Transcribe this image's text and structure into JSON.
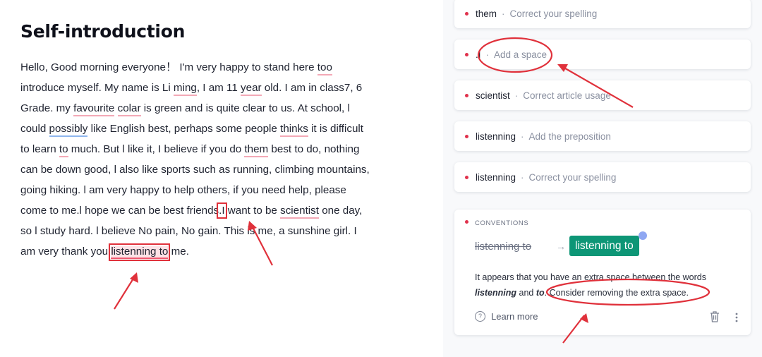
{
  "document": {
    "title": "Self-introduction",
    "lines": [
      [
        "Hello, Good morning everyone！ I'm very happy to stand here ",
        "too",
        ""
      ],
      [
        "introduce myself. My name is Li ",
        "ming",
        ", I am 11 ",
        "year",
        " old. I am in class7, 6"
      ],
      [
        "Grade. my ",
        "favourite",
        " ",
        "colar",
        " is green and is quite clear to us. At school, l"
      ],
      [
        "could ",
        "possibly",
        " like English best, perhaps some people ",
        "thinks",
        " it is difficult"
      ],
      [
        "to learn ",
        "to",
        " much. But l like it, I believe if you do ",
        "them",
        " best to do, nothing"
      ],
      [
        "can be down good, l also like sports such as running, climbing mountains,"
      ],
      [
        "going hiking. l am very happy to help others, if you need help, please"
      ],
      [
        "come to me.l  hope we can be best friends",
        ".I",
        " want to be ",
        "scientist",
        " one day,"
      ],
      [
        "so l study hard. l believe  No pain, No gain. This is me, a sunshine girl. I"
      ],
      [
        "am very thank you ",
        "listenning  to",
        " me."
      ]
    ]
  },
  "suggestions": [
    {
      "word": "them",
      "separator": "·",
      "hint": "Correct your spelling"
    },
    {
      "word": ".I",
      "separator": "·",
      "hint": "Add a space"
    },
    {
      "word": "scientist",
      "separator": "·",
      "hint": "Correct article usage"
    },
    {
      "word": "listenning",
      "separator": "·",
      "hint": "Add the preposition"
    },
    {
      "word": "listenning",
      "separator": "·",
      "hint": "Correct your spelling"
    }
  ],
  "active_card": {
    "category": "CONVENTIONS",
    "original": "listenning to",
    "arrow": "→",
    "replacement": "listenning to",
    "explanation_prefix": "It appears that you have an extra space between the words ",
    "word1": "listenning",
    "and": " and ",
    "word2": "to",
    "explanation_suffix": ". Consider removing the extra space.",
    "learn_more": "Learn more"
  },
  "colors": {
    "error_underline": "#f3a9b6",
    "clarity_underline": "#8fb6ee",
    "annotation_red": "#e0313b",
    "accept_green": "#0d9676"
  }
}
